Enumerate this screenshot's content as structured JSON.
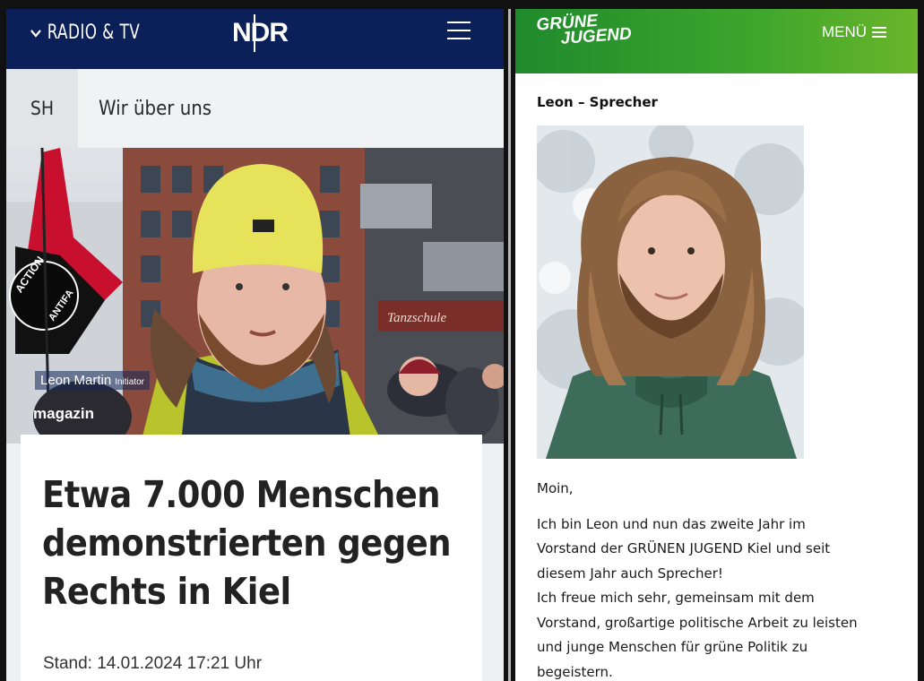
{
  "ndr": {
    "nav_label": "RADIO & TV",
    "logo": "NDR",
    "region": "SH",
    "subnav_link": "Wir über uns",
    "video_caption_name": "Leon Martin",
    "video_caption_role": "Initiator",
    "video_caption_show": "magazin",
    "flag_text": "ACTION ANTIFA",
    "headline": "Etwa 7.000 Menschen demonstrierten gegen Rechts in Kiel",
    "stand": "Stand: 14.01.2024 17:21 Uhr",
    "colors": {
      "header": "#0b1f58",
      "background": "#eef0f3"
    }
  },
  "gj": {
    "logo_line1": "GRÜNE",
    "logo_line2": "JUGEND",
    "menu_label": "MENÜ",
    "person_title": "Leon – Sprecher",
    "greeting": "Moin,",
    "bio_lines": [
      "Ich bin Leon und nun das zweite Jahr im",
      "Vorstand der GRÜNEN JUGEND Kiel und seit",
      "diesem Jahr auch Sprecher!",
      "Ich freue mich sehr, gemeinsam mit dem",
      "Vorstand, großartige politische Arbeit zu leisten",
      "und junge Menschen für grüne Politik zu",
      "begeistern."
    ],
    "colors": {
      "header_start": "#1f8a2c",
      "header_end": "#6ab52a"
    }
  }
}
